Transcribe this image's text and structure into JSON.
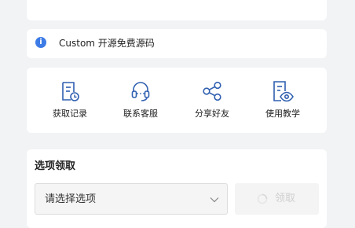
{
  "notice": {
    "icon": "info-icon",
    "text": "Custom 开源免费源码"
  },
  "actions": [
    {
      "label": "获取记录",
      "icon": "record-icon"
    },
    {
      "label": "联系客服",
      "icon": "headset-icon"
    },
    {
      "label": "分享好友",
      "icon": "share-icon"
    },
    {
      "label": "使用教学",
      "icon": "tutorial-icon"
    }
  ],
  "claim": {
    "title": "选项领取",
    "select_placeholder": "请选择选项",
    "button_label": "领取"
  },
  "colors": {
    "accent": "#2f5fb0",
    "info": "#3d7be6",
    "background": "#f2f3f5",
    "disabled_text": "#cfcfcf"
  }
}
